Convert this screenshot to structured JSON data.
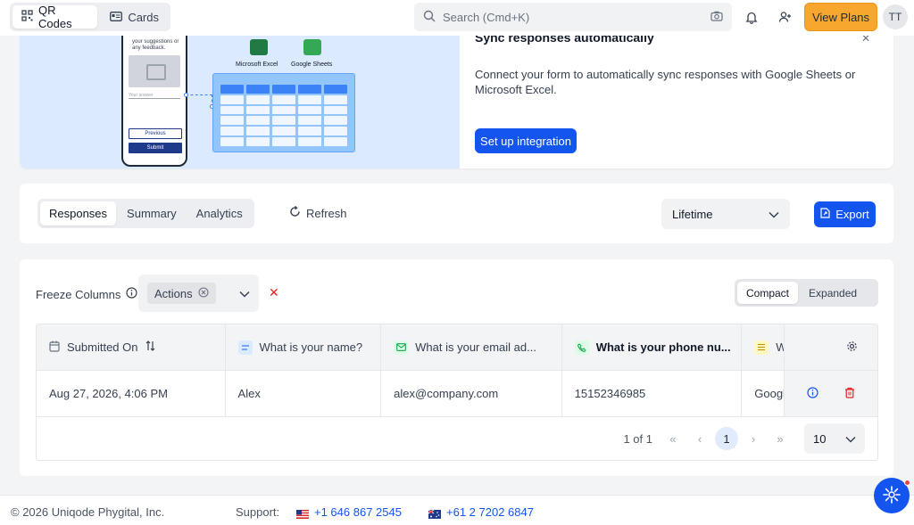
{
  "topbar": {
    "qr_codes_label": "QR Codes",
    "cards_label": "Cards",
    "search_placeholder": "Search (Cmd+K)",
    "view_plans_label": "View Plans",
    "avatar_initials": "TT"
  },
  "banner": {
    "title": "Sync responses automatically",
    "description": "Connect your form to automatically sync responses with Google Sheets or Microsoft Excel.",
    "setup_label": "Set up integration",
    "illustration": {
      "phone_prompt": "your suggestions or any feedback.",
      "phone_input": "Your answer",
      "phone_previous": "Previous",
      "phone_submit": "Submit",
      "excel_label": "Microsoft Excel",
      "sheets_label": "Google Sheets"
    }
  },
  "toolbar": {
    "tabs": [
      {
        "label": "Responses",
        "active": true
      },
      {
        "label": "Summary",
        "active": false
      },
      {
        "label": "Analytics",
        "active": false
      }
    ],
    "refresh_label": "Refresh",
    "period_value": "Lifetime",
    "export_label": "Export"
  },
  "table_controls": {
    "freeze_label": "Freeze Columns",
    "freeze_chip": "Actions",
    "view_modes": [
      {
        "label": "Compact",
        "active": true
      },
      {
        "label": "Expanded",
        "active": false
      }
    ]
  },
  "table": {
    "columns": [
      {
        "label": "Submitted On",
        "icon": "calendar-icon"
      },
      {
        "label": "What is your name?",
        "icon": "short-text-icon"
      },
      {
        "label": "What is your email ad...",
        "icon": "email-icon"
      },
      {
        "label": "What is your phone nu...",
        "icon": "phone-icon"
      },
      {
        "label": "W",
        "icon": "list-icon"
      }
    ],
    "rows": [
      [
        "Aug 27, 2026, 4:06 PM",
        "Alex",
        "alex@company.com",
        "15152346985",
        "Googl"
      ]
    ]
  },
  "pagination": {
    "summary": "1 of 1",
    "current_page": "1",
    "per_page": "10"
  },
  "footer": {
    "copyright": "© 2026 Uniqode Phygital, Inc.",
    "support_label": "Support:",
    "us_phone": "+1 646 867 2545",
    "au_phone": "+61 2 7202 6847"
  },
  "colors": {
    "primary": "#1455f0",
    "plans": "#f7a72e",
    "danger": "#e02424"
  }
}
